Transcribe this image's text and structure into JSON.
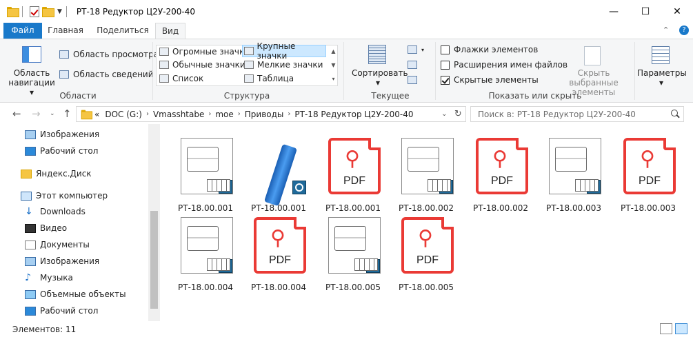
{
  "window": {
    "title": "РТ-18 Редуктор Ц2У-200-40",
    "controls": {
      "minimize": "—",
      "maximize": "☐",
      "close": "✕"
    }
  },
  "tabs": {
    "file": "Файл",
    "home": "Главная",
    "share": "Поделиться",
    "view": "Вид"
  },
  "ribbon": {
    "panes": {
      "nav_pane_line1": "Область",
      "nav_pane_line2": "навигации",
      "preview": "Область просмотра",
      "details": "Область сведений",
      "group_label": "Области"
    },
    "layout": {
      "items": [
        "Огромные значки",
        "Крупные значки",
        "Обычные значки",
        "Мелкие значки",
        "Список",
        "Таблица"
      ],
      "group_label": "Структура"
    },
    "current_view": {
      "sort": "Сортировать",
      "group_label": "Текущее представлен..."
    },
    "show_hide": {
      "item_checkboxes": "Флажки элементов",
      "file_extensions": "Расширения имен файлов",
      "hidden_items": "Скрытые элементы",
      "hide_selected_line1": "Скрыть выбранные",
      "hide_selected_line2": "элементы",
      "group_label": "Показать или скрыть"
    },
    "options": "Параметры"
  },
  "address": {
    "prefix": "«",
    "crumbs": [
      "DOC (G:)",
      "Vmasshtabe",
      "moe",
      "Приводы",
      "РТ-18 Редуктор Ц2У-200-40"
    ],
    "search_placeholder": "Поиск в: РТ-18 Редуктор Ц2У-200-40"
  },
  "nav": {
    "items": [
      "Изображения",
      "Рабочий стол",
      "Яндекс.Диск",
      "Этот компьютер",
      "Downloads",
      "Видео",
      "Документы",
      "Изображения",
      "Музыка",
      "Объемные объекты",
      "Рабочий стол"
    ]
  },
  "files": [
    {
      "name": "РТ-18.00.001",
      "type": "drawing"
    },
    {
      "name": "РТ-18.00.001",
      "type": "model"
    },
    {
      "name": "РТ-18.00.001",
      "type": "pdf"
    },
    {
      "name": "РТ-18.00.002",
      "type": "drawing"
    },
    {
      "name": "РТ-18.00.002",
      "type": "pdf"
    },
    {
      "name": "РТ-18.00.003",
      "type": "drawing"
    },
    {
      "name": "РТ-18.00.003",
      "type": "pdf"
    },
    {
      "name": "РТ-18.00.004",
      "type": "drawing"
    },
    {
      "name": "РТ-18.00.004",
      "type": "pdf"
    },
    {
      "name": "РТ-18.00.005",
      "type": "drawing"
    },
    {
      "name": "РТ-18.00.005",
      "type": "pdf"
    }
  ],
  "pdf_label": "PDF",
  "status": {
    "count": "Элементов: 11"
  },
  "colors": {
    "accent": "#1979ca",
    "pdf": "#ea3a35",
    "kompas": "#1f6a9a"
  }
}
